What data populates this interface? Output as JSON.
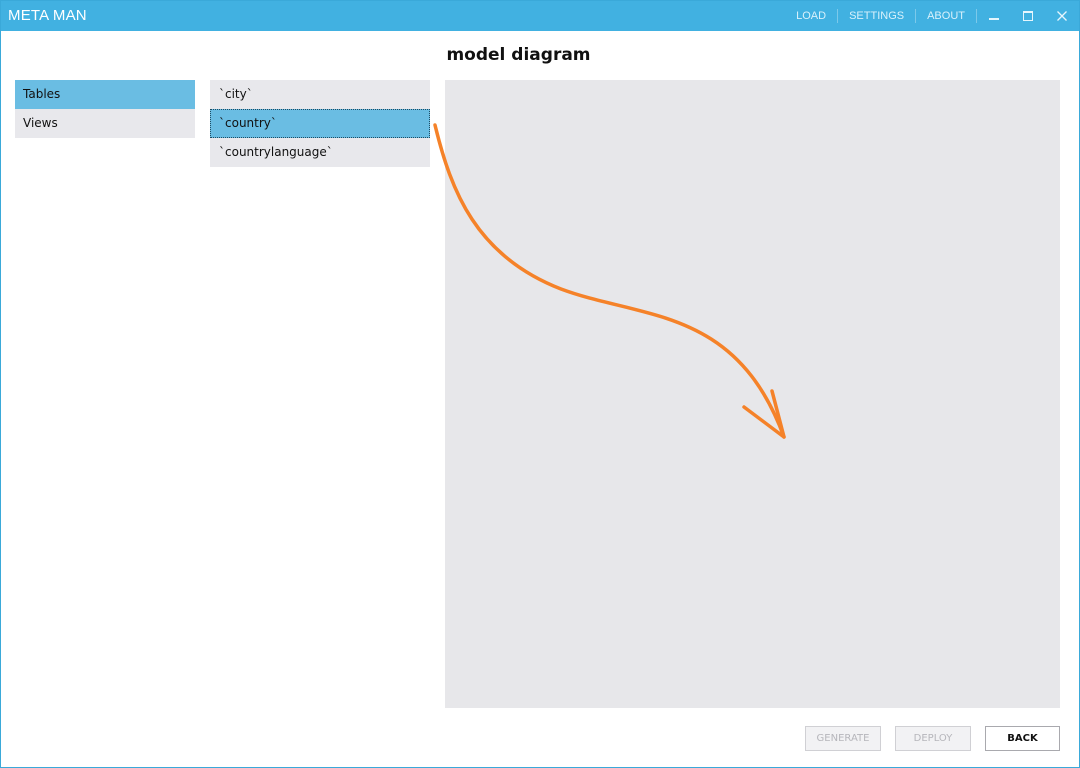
{
  "app": {
    "title": "META MAN"
  },
  "titlebar": {
    "menu": [
      "LOAD",
      "SETTINGS",
      "ABOUT"
    ],
    "icons": [
      "minimize-icon",
      "maximize-icon",
      "close-icon"
    ]
  },
  "page": {
    "title": "model diagram"
  },
  "left_nav": {
    "items": [
      {
        "label": "Tables",
        "selected": true
      },
      {
        "label": "Views",
        "selected": false
      }
    ]
  },
  "table_list": {
    "items": [
      {
        "label": "`city`",
        "selected": false
      },
      {
        "label": "`country`",
        "selected": true
      },
      {
        "label": "`countrylanguage`",
        "selected": false
      }
    ]
  },
  "footer": {
    "generate_label": "GENERATE",
    "generate_enabled": false,
    "deploy_label": "DEPLOY",
    "deploy_enabled": false,
    "back_label": "BACK",
    "back_enabled": true
  },
  "colors": {
    "titlebar": "#41b1e1",
    "selection": "#6abde3",
    "panel": "#e8e8ec",
    "annotation_arrow": "#f58229"
  }
}
